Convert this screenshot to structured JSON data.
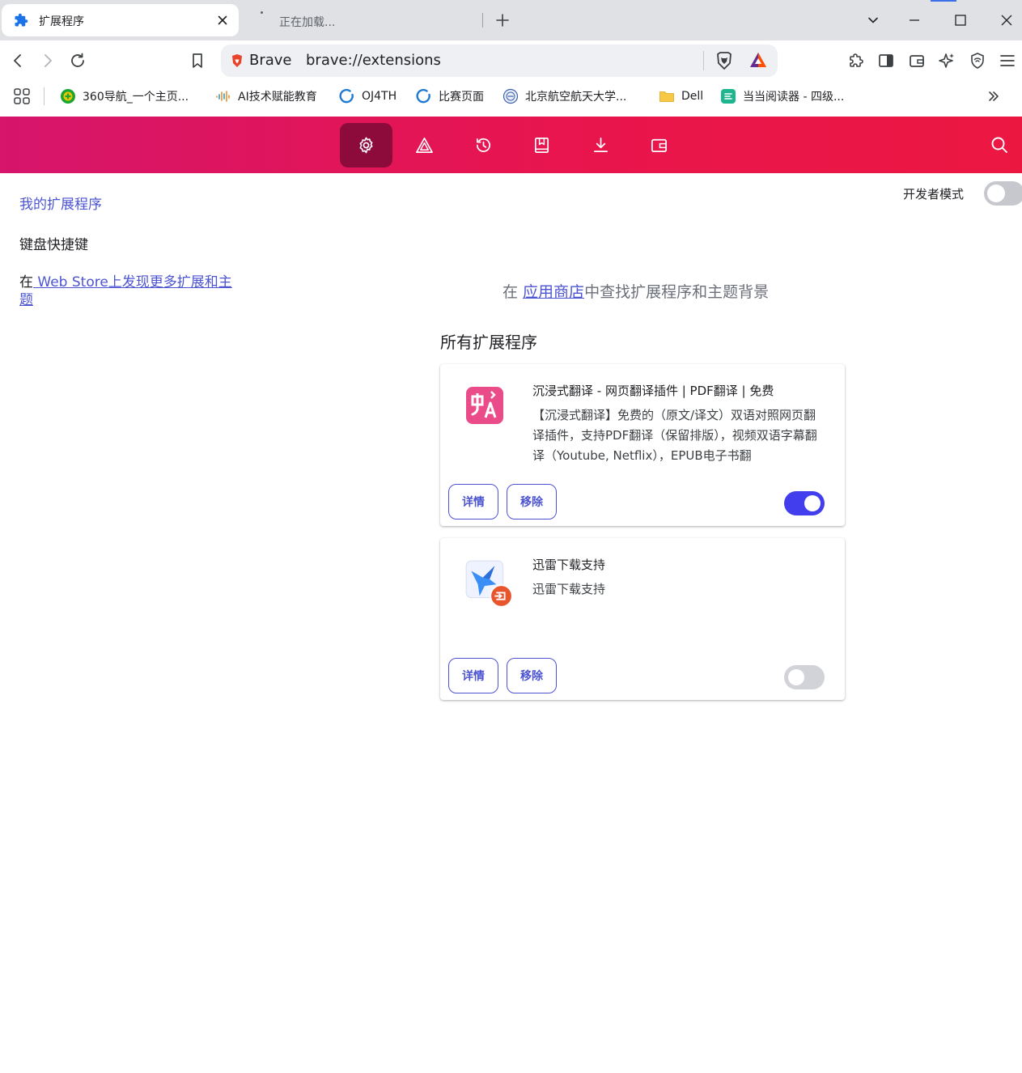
{
  "browser": {
    "tabs": [
      {
        "title": "扩展程序",
        "active": true
      },
      {
        "title": "正在加载...",
        "active": false
      }
    ],
    "omnibox": {
      "brand": "Brave",
      "url": "brave://extensions"
    },
    "bookmarks": [
      {
        "label": "360导航_一个主页...",
        "icon": "360-icon"
      },
      {
        "label": "AI技术赋能教育",
        "icon": "audio-wave-icon"
      },
      {
        "label": "OJ4TH",
        "icon": "c-ring-icon"
      },
      {
        "label": "比赛页面",
        "icon": "c-ring-icon"
      },
      {
        "label": "北京航空航天大学...",
        "icon": "buaa-seal-icon"
      },
      {
        "label": "Dell",
        "icon": "folder-icon"
      },
      {
        "label": "当当阅读器 - 四级...",
        "icon": "dangdang-icon"
      }
    ]
  },
  "header": {
    "nav": [
      "settings",
      "rewards",
      "history",
      "bookmarks",
      "downloads",
      "wallet"
    ],
    "active": "settings",
    "colors": {
      "start": "#d6156b",
      "end": "#ec1741",
      "active_bg": "#8c0b3b"
    }
  },
  "sidebar": {
    "my_extensions": "我的扩展程序",
    "keyboard_shortcuts": "键盘快捷键",
    "store_prefix": "在",
    "store_link": " Web Store上发现更多扩展和主题"
  },
  "developer_mode": {
    "label": "开发者模式",
    "enabled": false
  },
  "main": {
    "find_prefix": "在 ",
    "find_link": "应用商店",
    "find_suffix": "中查找扩展程序和主题背景",
    "section_title": "所有扩展程序",
    "extensions": [
      {
        "name": "沉浸式翻译 - 网页翻译插件 | PDF翻译 | 免费",
        "description": "【沉浸式翻译】免费的（原文/译文）双语对照网页翻译插件，支持PDF翻译（保留排版），视频双语字幕翻译（Youtube, Netflix），EPUB电子书翻",
        "details_label": "详情",
        "remove_label": "移除",
        "enabled": true,
        "icon": "immersive-translate-icon"
      },
      {
        "name": "迅雷下载支持",
        "description": "迅雷下载支持",
        "details_label": "详情",
        "remove_label": "移除",
        "enabled": false,
        "icon": "thunder-download-icon"
      }
    ]
  },
  "colors": {
    "accent": "#4c54d2",
    "toggle_on": "#423eee"
  }
}
